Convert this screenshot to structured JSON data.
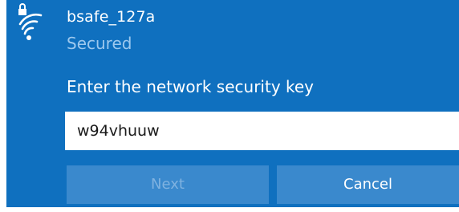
{
  "colors": {
    "panel_background": "#0f70bf",
    "status_text": "#9cc8ee",
    "button_background": "#3a89cd",
    "disabled_text": "#7fb2e0",
    "input_background": "#ffffff"
  },
  "network": {
    "icon": "wifi-secured-icon",
    "name": "bsafe_127a",
    "status": "Secured"
  },
  "security_key": {
    "label": "Enter the network security key",
    "value": "w94vhuuw"
  },
  "buttons": {
    "next_label": "Next",
    "next_enabled": false,
    "cancel_label": "Cancel"
  }
}
